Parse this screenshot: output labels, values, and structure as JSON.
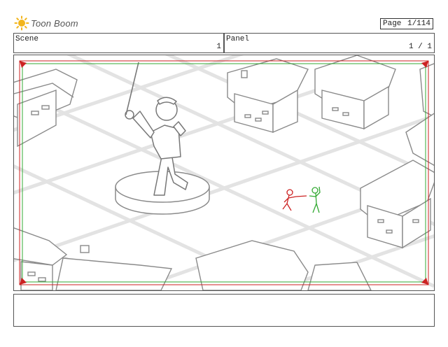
{
  "brand": {
    "logo_text": "Toon Boom"
  },
  "page": {
    "label": "Page",
    "value": "1/114"
  },
  "scene": {
    "label": "Scene",
    "value": "1"
  },
  "panel": {
    "label": "Panel",
    "value": "1 / 1"
  },
  "colors": {
    "safe_frame": "#cc2222",
    "camera_frame": "#33aa33",
    "sketch": "#999999"
  }
}
